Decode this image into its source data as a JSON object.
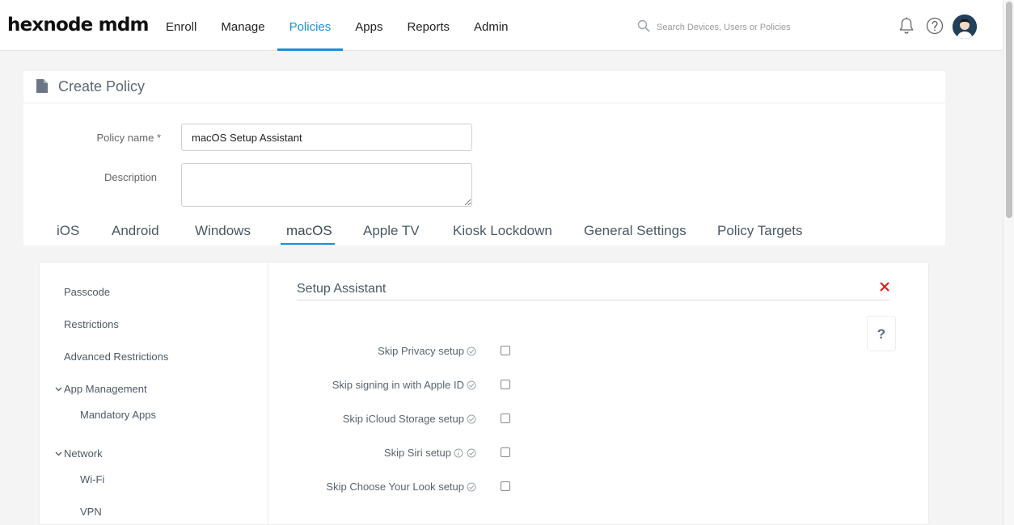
{
  "brand": {
    "logo": "hexnode mdm"
  },
  "nav": {
    "items": [
      {
        "label": "Enroll"
      },
      {
        "label": "Manage"
      },
      {
        "label": "Policies"
      },
      {
        "label": "Apps"
      },
      {
        "label": "Reports"
      },
      {
        "label": "Admin"
      }
    ],
    "active": "Policies"
  },
  "search": {
    "placeholder": "Search Devices, Users or Policies"
  },
  "page": {
    "title": "Create Policy"
  },
  "form": {
    "policy_name_label": "Policy name",
    "required_mark": "*",
    "policy_name_value": "macOS Setup Assistant",
    "description_label": "Description",
    "description_value": ""
  },
  "tabs": {
    "items": [
      {
        "label": "iOS"
      },
      {
        "label": "Android"
      },
      {
        "label": "Windows"
      },
      {
        "label": "macOS"
      },
      {
        "label": "Apple TV"
      },
      {
        "label": "Kiosk Lockdown"
      },
      {
        "label": "General Settings"
      },
      {
        "label": "Policy Targets"
      }
    ],
    "active": "macOS"
  },
  "sidebar": {
    "items": [
      {
        "label": "Passcode"
      },
      {
        "label": "Restrictions"
      },
      {
        "label": "Advanced Restrictions"
      },
      {
        "label": "App Management"
      },
      {
        "label": "Mandatory Apps"
      },
      {
        "label": "Network"
      },
      {
        "label": "Wi-Fi"
      },
      {
        "label": "VPN"
      }
    ]
  },
  "section": {
    "title": "Setup Assistant",
    "help_label": "?",
    "options": [
      {
        "label": "Skip Privacy setup",
        "checked": false,
        "has_info": false
      },
      {
        "label": "Skip signing in with Apple ID",
        "checked": false,
        "has_info": false
      },
      {
        "label": "Skip iCloud Storage setup",
        "checked": false,
        "has_info": false
      },
      {
        "label": "Skip Siri setup",
        "checked": false,
        "has_info": true
      },
      {
        "label": "Skip Choose Your Look setup",
        "checked": false,
        "has_info": false
      }
    ]
  },
  "colors": {
    "accent": "#1b8ed8",
    "close": "#e02020",
    "text_muted": "#59636e"
  },
  "icons": [
    "search-icon",
    "bell-icon",
    "help-circle-icon",
    "user-avatar-icon",
    "document-icon",
    "close-icon",
    "check-circle-icon",
    "info-icon",
    "chevron-down-icon"
  ]
}
